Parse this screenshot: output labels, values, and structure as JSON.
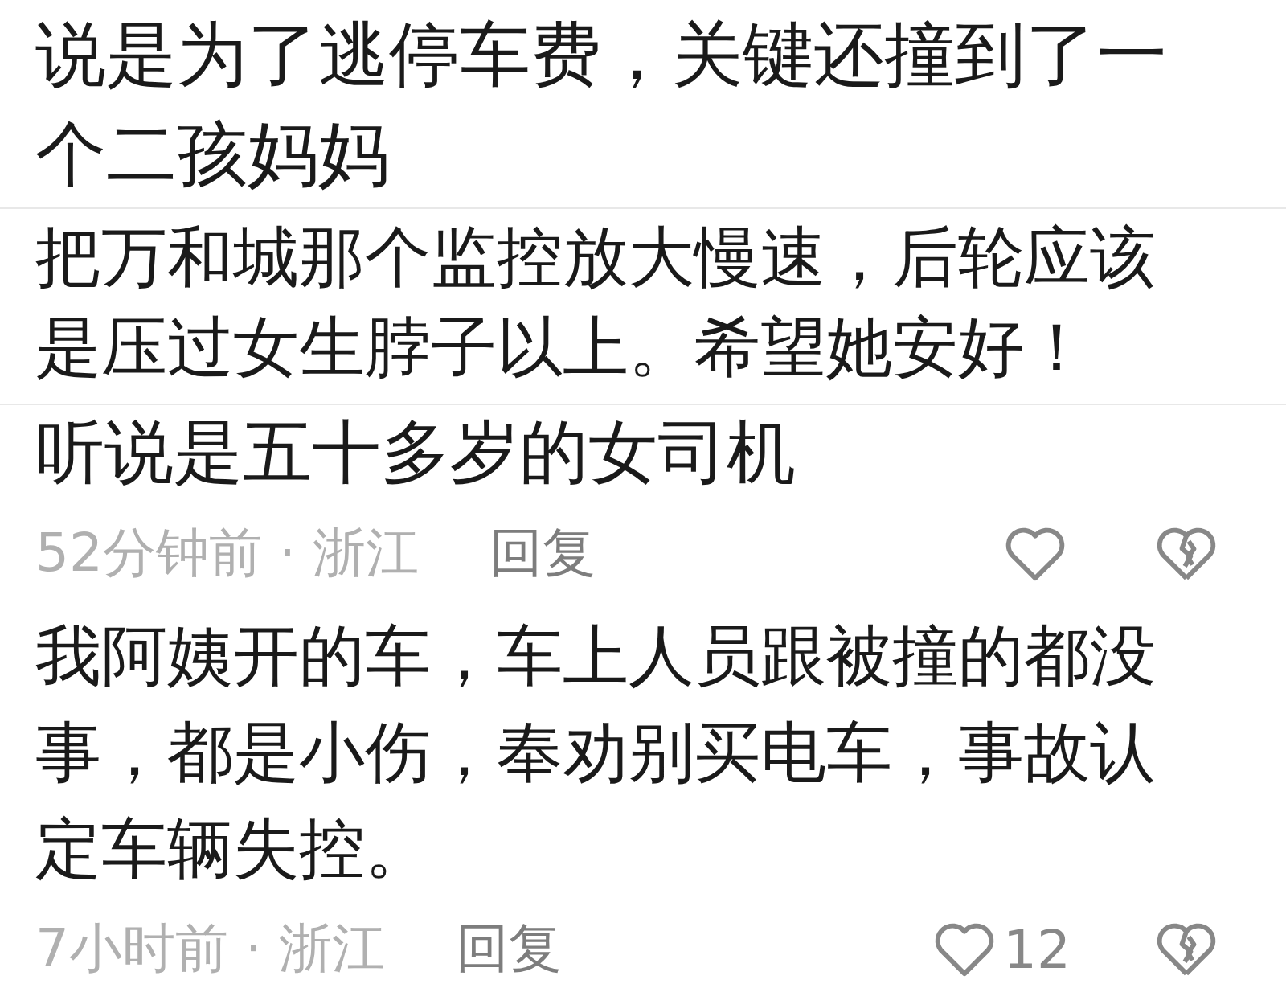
{
  "strips": [
    {
      "comments": [
        {
          "text": "说是为了逃停车费，关键还撞到了一个二孩妈妈"
        }
      ]
    },
    {
      "comments": [
        {
          "text": "把万和城那个监控放大慢速，后轮应该是压过女生脖子以上。希望她安好！"
        }
      ]
    },
    {
      "comments": [
        {
          "text": "听说是五十多岁的女司机",
          "meta": {
            "info": "52分钟前 · 浙江",
            "reply": "回复"
          }
        },
        {
          "text": "我阿姨开的车，车上人员跟被撞的都没事，都是小伤，奉劝别买电车，事故认定车辆失控。",
          "meta": {
            "info": "7小时前 · 浙江",
            "reply": "回复",
            "likes": "12"
          }
        }
      ]
    }
  ]
}
